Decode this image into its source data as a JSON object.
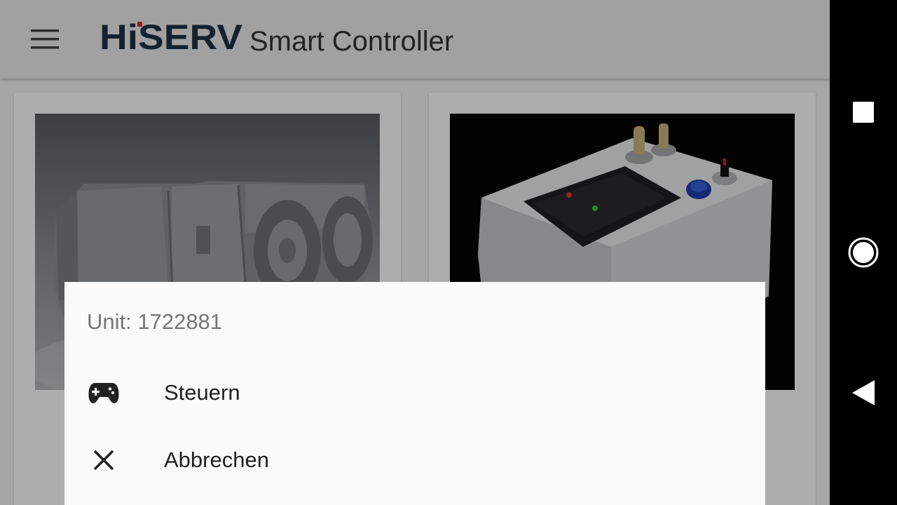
{
  "app": {
    "logo_text": "HiSERV",
    "title": "Smart Controller"
  },
  "cards": [
    {
      "image": "vehicle-3d-model-image"
    },
    {
      "image": "control-box-keypad-image"
    }
  ],
  "sheet": {
    "title": "Unit: 1722881",
    "items": [
      {
        "label": "Steuern",
        "icon": "gamepad-icon"
      },
      {
        "label": "Abbrechen",
        "icon": "close-icon"
      }
    ]
  },
  "navbar": {
    "buttons": [
      "recent-apps-icon",
      "home-icon",
      "back-icon"
    ]
  },
  "colors": {
    "toolbar": "#eeeeee",
    "logo_blue": "#1e3146",
    "logo_red": "#d62e2e",
    "sheet_bg": "#fafafa",
    "nav_bg": "#000000"
  }
}
